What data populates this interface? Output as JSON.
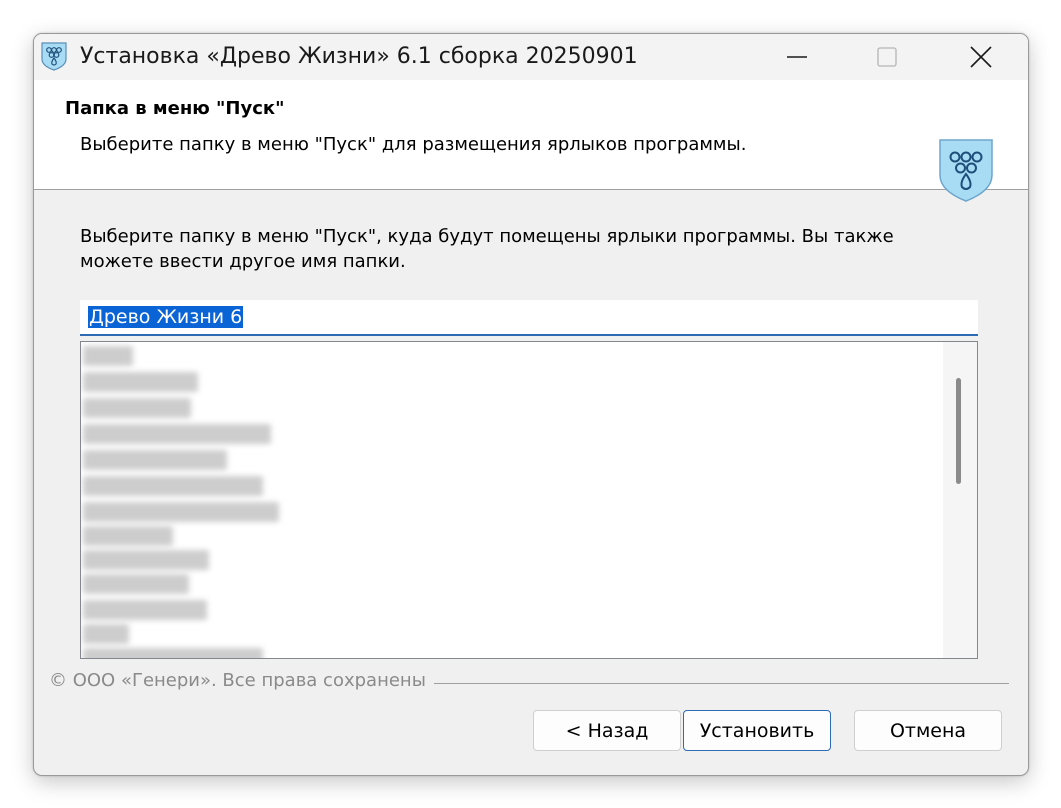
{
  "window": {
    "title": "Установка «Древо Жизни» 6.1 сборка 20250901"
  },
  "header": {
    "title": "Папка в меню \"Пуск\"",
    "subtitle": "Выберите папку в меню \"Пуск\" для размещения ярлыков программы."
  },
  "main": {
    "description": "Выберите папку в меню \"Пуск\", куда будут помещены ярлыки программы. Вы также можете ввести другое имя папки.",
    "folder_input_value": "Древо Жизни 6",
    "folder_list_blurred_items": 13
  },
  "footer": {
    "copyright": "© ООО «Генери». Все права сохранены"
  },
  "buttons": {
    "back": "< Назад",
    "install": "Установить",
    "cancel": "Отмена"
  },
  "colors": {
    "accent": "#2d6cb5",
    "selection": "#0a64d6",
    "logo_fill": "#a8dcf4",
    "logo_stroke": "#1e4e7a"
  },
  "icons": {
    "app": "tree-of-life-shield-icon",
    "minimize": "minimize-icon",
    "maximize": "maximize-icon",
    "close": "close-icon"
  }
}
